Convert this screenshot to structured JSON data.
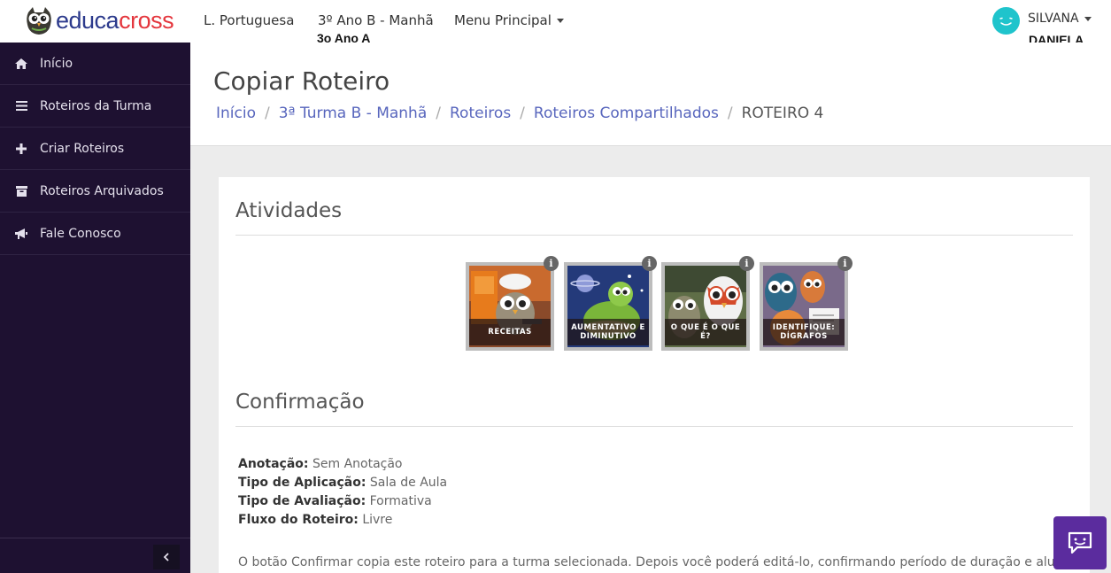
{
  "brand": {
    "part1": "educa",
    "part2": "cross",
    "color_primary": "#2c3a8c",
    "color_accent": "#e4363d"
  },
  "topnav": {
    "subject": "L. Portuguesa",
    "class": "3º Ano B - Manhã",
    "class_sub": "3o Ano A",
    "menu": "Menu Principal",
    "user_first": "SILVANA",
    "user_last": "DANIELA"
  },
  "sidebar": {
    "items": [
      {
        "label": "Início",
        "icon": "home-icon"
      },
      {
        "label": "Roteiros da Turma",
        "icon": "list-icon"
      },
      {
        "label": "Criar Roteiros",
        "icon": "plus-icon"
      },
      {
        "label": "Roteiros Arquivados",
        "icon": "archive-icon"
      },
      {
        "label": "Fale Conosco",
        "icon": "megaphone-icon"
      }
    ],
    "collapse_icon": "chevron-left-icon",
    "bg_color": "#1e1131"
  },
  "page": {
    "title": "Copiar Roteiro",
    "breadcrumb": [
      "Início",
      "3ª Turma B - Manhã",
      "Roteiros",
      "Roteiros Compartilhados"
    ],
    "breadcrumb_active": "ROTEIRO 4"
  },
  "activities": {
    "title": "Atividades",
    "items": [
      {
        "label": "RECEITAS"
      },
      {
        "label": "AUMENTATIVO E DIMINUTIVO"
      },
      {
        "label": "O QUE É O QUE É?"
      },
      {
        "label": "IDENTIFIQUE: DÍGRAFOS"
      }
    ]
  },
  "confirmation": {
    "title": "Confirmação",
    "fields": [
      {
        "key": "Anotação:",
        "value": "Sem Anotação"
      },
      {
        "key": "Tipo de Aplicação:",
        "value": "Sala de Aula"
      },
      {
        "key": "Tipo de Avaliação:",
        "value": "Formativa"
      },
      {
        "key": "Fluxo do Roteiro:",
        "value": "Livre"
      }
    ],
    "text": "O botão Confirmar copia este roteiro para a turma selecionada. Depois você poderá editá-lo, confirmando período de duração e alunos"
  },
  "chat": {
    "icon": "chat-icon",
    "color": "#5b2c9e"
  }
}
